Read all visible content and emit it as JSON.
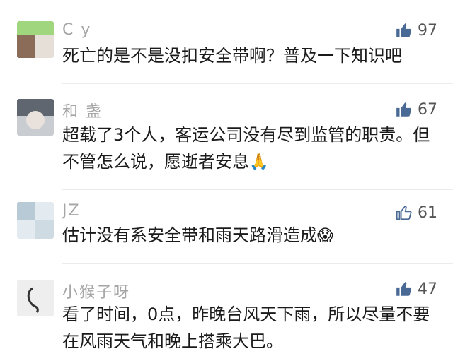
{
  "comments": [
    {
      "nickname": "C  y",
      "likes": "97",
      "liked": true,
      "text": "死亡的是不是没扣安全带啊？普及一下知识吧",
      "emoji": ""
    },
    {
      "nickname": "和  盏",
      "likes": "67",
      "liked": true,
      "text": "超载了3个人，客运公司没有尽到监管的职责。但不管怎么说，愿逝者安息",
      "emoji": "🙏"
    },
    {
      "nickname": "JZ",
      "likes": "61",
      "liked": false,
      "text": "估计没有系安全带和雨天路滑造成",
      "emoji": "😱"
    },
    {
      "nickname": "小猴子呀",
      "likes": "47",
      "liked": true,
      "text": "看了时间，0点，昨晚台风天下雨，所以尽量不要在风雨天气和晚上搭乘大巴。",
      "emoji": ""
    }
  ],
  "colors": {
    "like_icon": "#4a6a96",
    "text": "#1a1a1a",
    "nickname": "#a6a6a6"
  },
  "icons": {
    "liked": "thumbs-up-filled-icon",
    "not_liked": "thumbs-up-outline-icon"
  }
}
